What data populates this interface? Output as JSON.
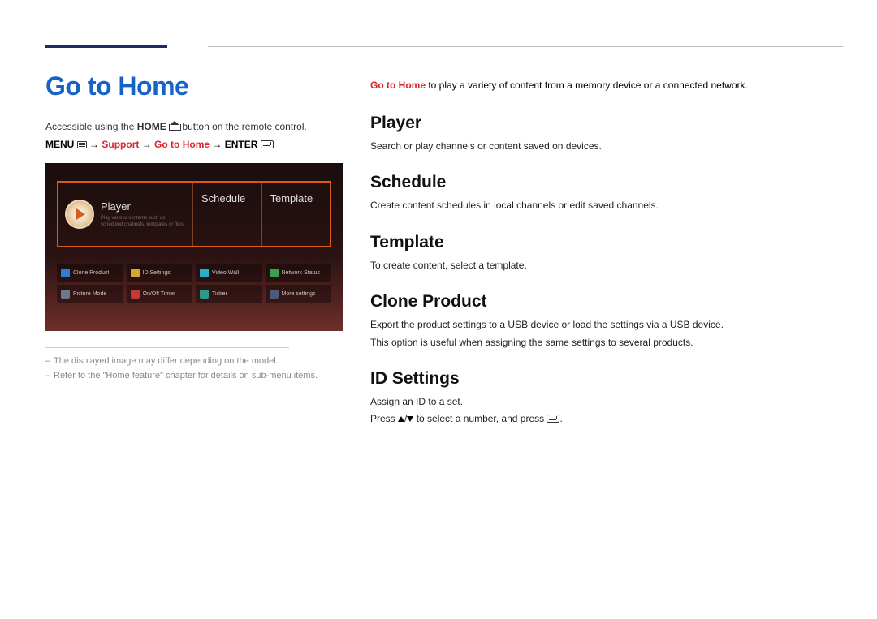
{
  "header": {
    "title": "Go to Home"
  },
  "left": {
    "accessible_pre": "Accessible using the ",
    "accessible_bold": "HOME",
    "accessible_post": " button on the remote control.",
    "menu_label": "MENU",
    "path_arrow": " → ",
    "path_support": "Support",
    "path_goto": "Go to Home",
    "path_enter": "ENTER",
    "tiles": {
      "player_title": "Player",
      "player_sub": "Play various contents such as scheduled channels, templates or files.",
      "schedule_title": "Schedule",
      "template_title": "Template"
    },
    "chips": [
      "Clone Product",
      "ID Settings",
      "Video Wall",
      "Network Status",
      "Picture Mode",
      "On/Off Timer",
      "Ticker",
      "More settings"
    ],
    "footnote1": "The displayed image may differ depending on the model.",
    "footnote2": "Refer to the \"Home feature\" chapter for details on sub-menu items."
  },
  "right": {
    "intro_hl": "Go to Home",
    "intro_rest": " to play a variety of content from a memory device or a connected network.",
    "sections": {
      "player_h": "Player",
      "player_p": "Search or play channels or content saved on devices.",
      "schedule_h": "Schedule",
      "schedule_p": "Create content schedules in local channels or edit saved channels.",
      "template_h": "Template",
      "template_p": "To create content, select a template.",
      "clone_h": "Clone Product",
      "clone_p1": "Export the product settings to a USB device or load the settings via a USB device.",
      "clone_p2": "This option is useful when assigning the same settings to several products.",
      "id_h": "ID Settings",
      "id_p1": "Assign an ID to a set.",
      "id_p2a": "Press ",
      "id_p2b": " to select a number, and press ",
      "id_p2c": "."
    }
  }
}
